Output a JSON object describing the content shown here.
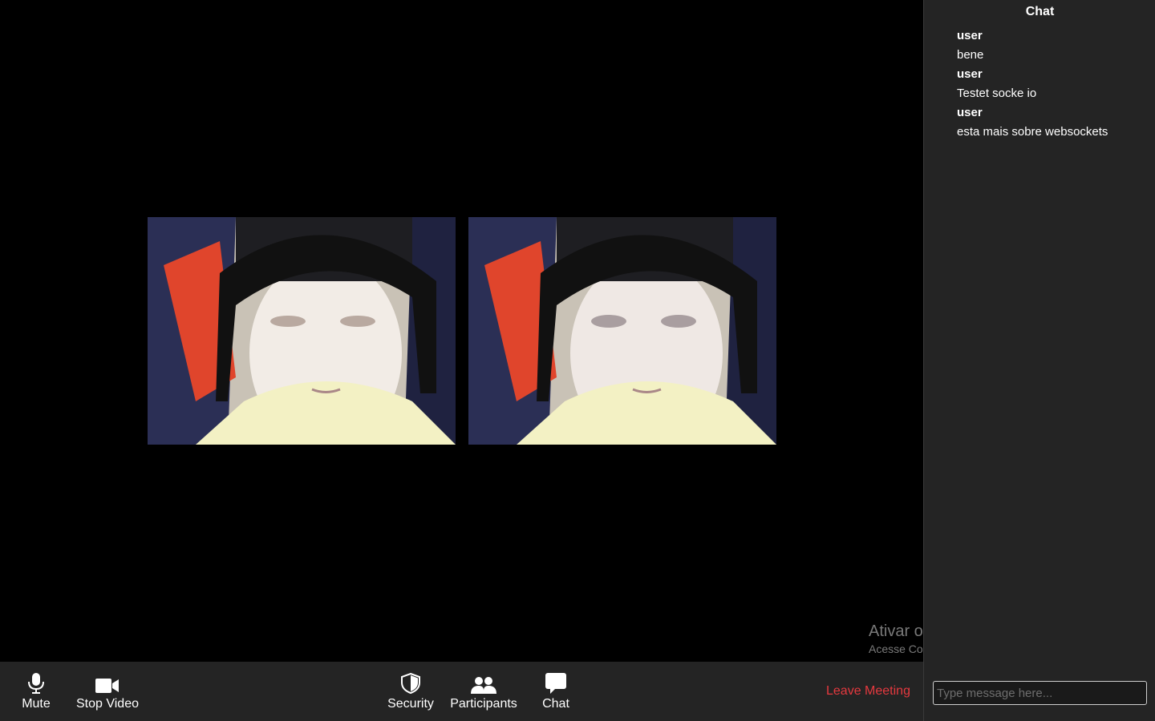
{
  "toolbar": {
    "mute_label": "Mute",
    "stop_video_label": "Stop Video",
    "security_label": "Security",
    "participants_label": "Participants",
    "chat_label": "Chat",
    "leave_label": "Leave Meeting",
    "leave_color": "#e5393f",
    "background": "#242424"
  },
  "video": {
    "tiles": [
      {
        "icon": "webcam-feed"
      },
      {
        "icon": "webcam-feed"
      }
    ]
  },
  "chat": {
    "title": "Chat",
    "messages": [
      {
        "user": "user",
        "text": "bene"
      },
      {
        "user": "user",
        "text": "Testet socke io"
      },
      {
        "user": "user",
        "text": "esta mais sobre websockets"
      }
    ],
    "input_placeholder": "Type message here..."
  },
  "watermark": {
    "title": "Ativar o Windows",
    "subtitle": "Acesse Configurações para ativar o Windows."
  }
}
